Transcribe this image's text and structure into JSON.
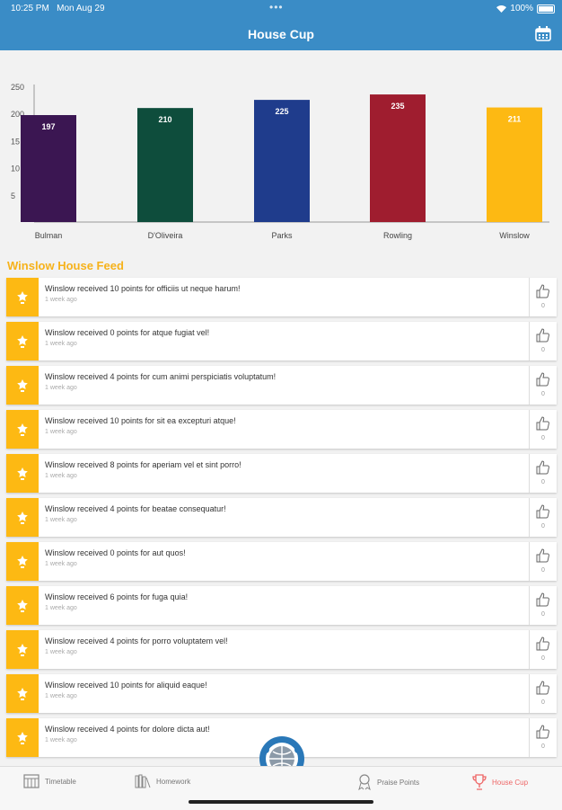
{
  "status": {
    "time": "10:25 PM",
    "date": "Mon Aug 29",
    "battery": "100%"
  },
  "nav": {
    "title": "House Cup"
  },
  "chart_data": {
    "type": "bar",
    "categories": [
      "Bulman",
      "D'Oliveira",
      "Parks",
      "Rowling",
      "Winslow"
    ],
    "values": [
      197,
      210,
      225,
      235,
      211
    ],
    "colors": [
      "#3b1652",
      "#0e4d3c",
      "#1f3c8c",
      "#9f1d2f",
      "#fdb913"
    ],
    "ylim": [
      0,
      250
    ],
    "yticks": [
      "250",
      "200",
      "15",
      "10",
      "5"
    ]
  },
  "feed": {
    "title": "Winslow House Feed",
    "items": [
      {
        "text": "Winslow received 10 points for officiis ut neque harum!",
        "time": "1 week ago",
        "likes": "0"
      },
      {
        "text": "Winslow received 0 points for atque fugiat vel!",
        "time": "1 week ago",
        "likes": "0"
      },
      {
        "text": "Winslow received 4 points for cum animi perspiciatis voluptatum!",
        "time": "1 week ago",
        "likes": "0"
      },
      {
        "text": "Winslow received 10 points for sit ea excepturi atque!",
        "time": "1 week ago",
        "likes": "0"
      },
      {
        "text": "Winslow received 8 points for aperiam vel et sint porro!",
        "time": "1 week ago",
        "likes": "0"
      },
      {
        "text": "Winslow received 4 points for beatae consequatur!",
        "time": "1 week ago",
        "likes": "0"
      },
      {
        "text": "Winslow received 0 points for aut quos!",
        "time": "1 week ago",
        "likes": "0"
      },
      {
        "text": "Winslow received 6 points for fuga quia!",
        "time": "1 week ago",
        "likes": "0"
      },
      {
        "text": "Winslow received 4 points for porro voluptatem vel!",
        "time": "1 week ago",
        "likes": "0"
      },
      {
        "text": "Winslow received 10 points for aliquid eaque!",
        "time": "1 week ago",
        "likes": "0"
      },
      {
        "text": "Winslow received 4 points for dolore dicta aut!",
        "time": "1 week ago",
        "likes": "0"
      }
    ]
  },
  "tabs": [
    {
      "label": "Timetable",
      "icon": "timetable-icon"
    },
    {
      "label": "Homework",
      "icon": "homework-icon"
    },
    {
      "label": "Praise Points",
      "icon": "praise-points-icon"
    },
    {
      "label": "House Cup",
      "icon": "house-cup-icon",
      "active": true
    }
  ]
}
